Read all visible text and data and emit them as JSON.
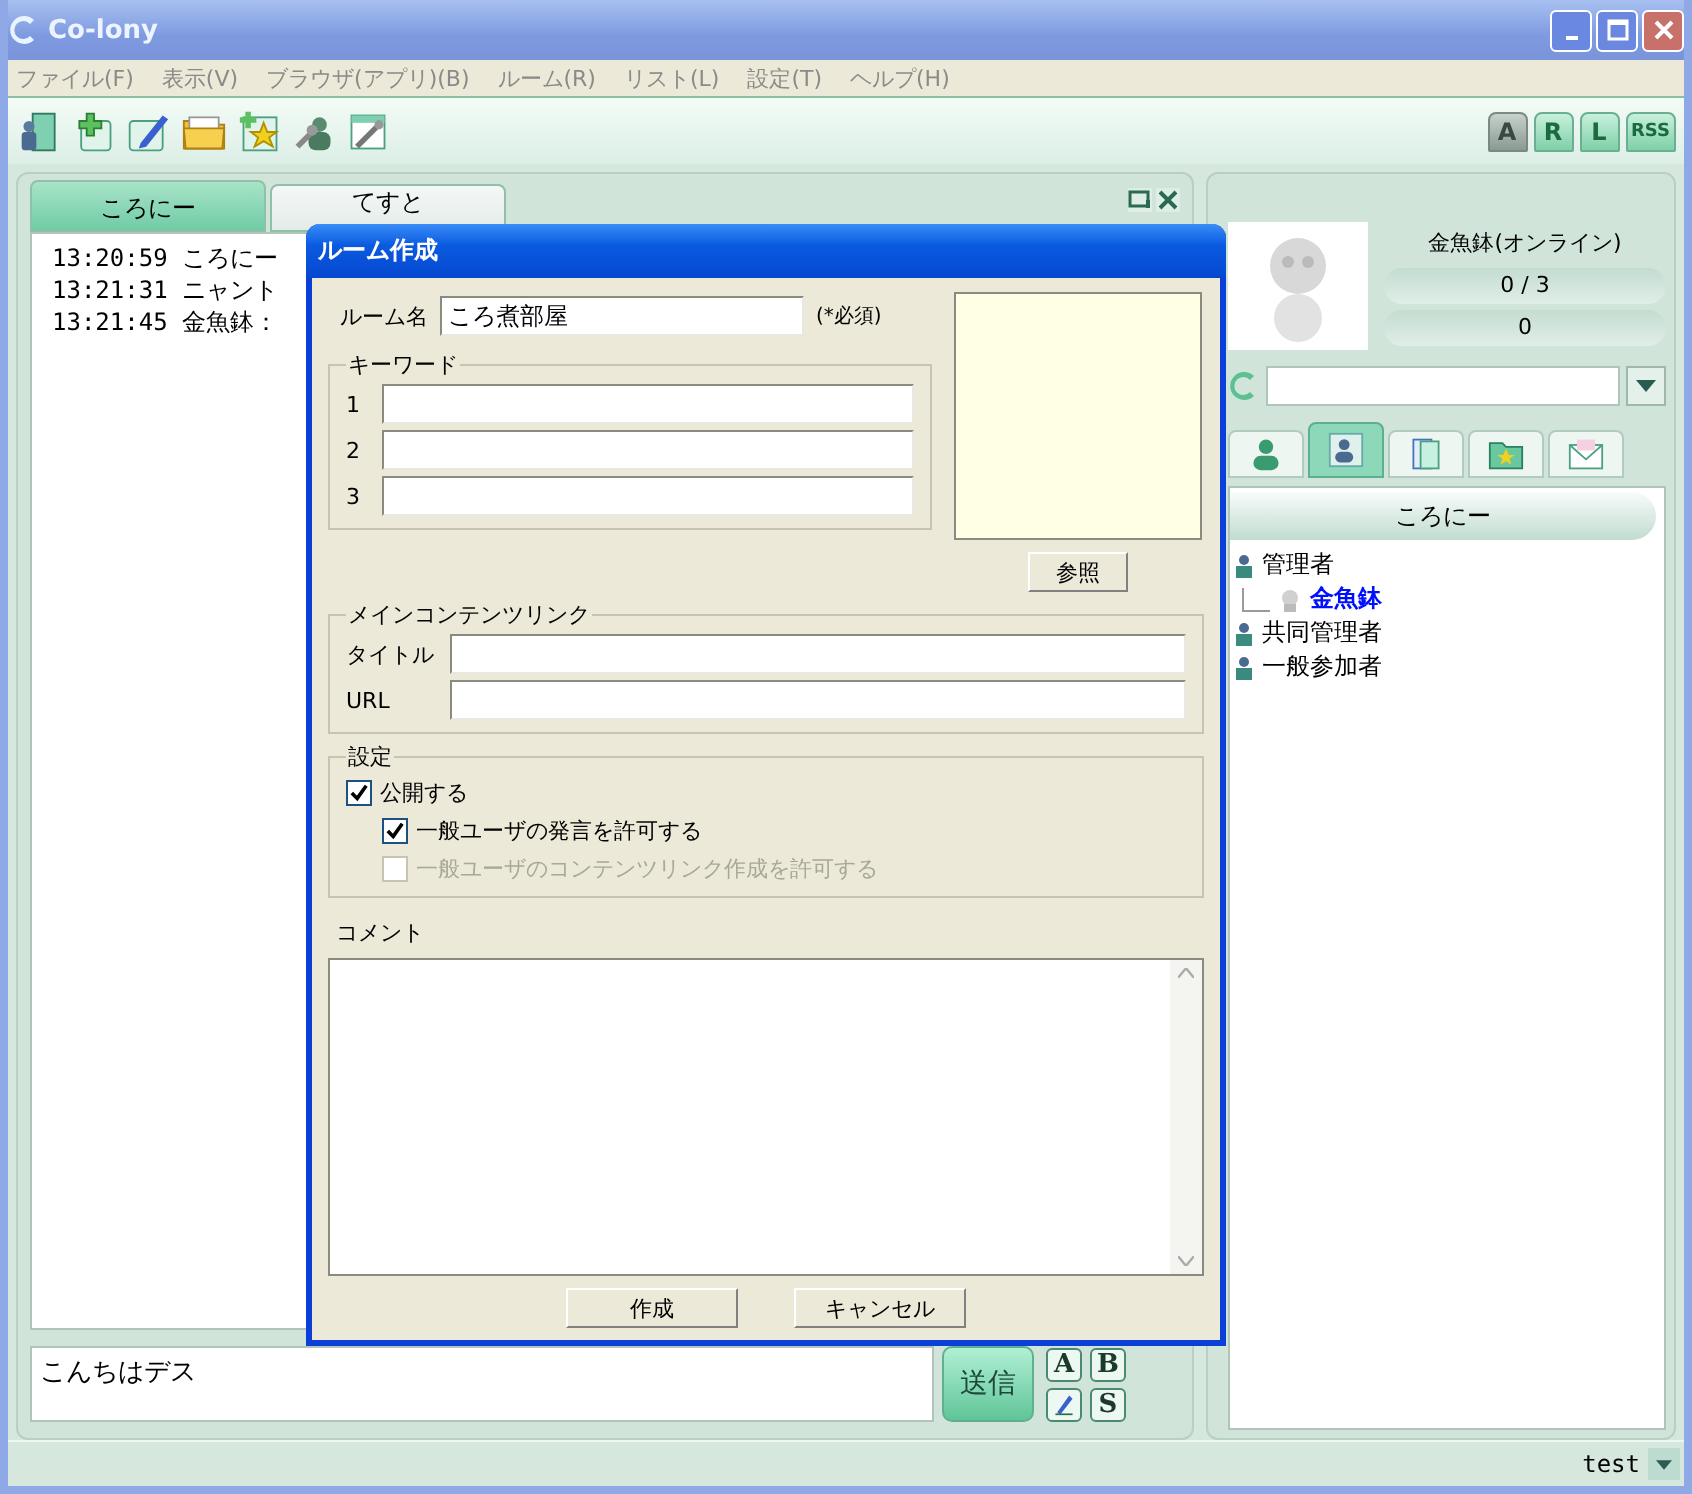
{
  "window": {
    "title": "Co-lony"
  },
  "menu": [
    "ファイル(F)",
    "表示(V)",
    "ブラウザ(アプリ)(B)",
    "ルーム(R)",
    "リスト(L)",
    "設定(T)",
    "ヘルプ(H)"
  ],
  "toolbar": [
    {
      "kind": "door"
    },
    {
      "kind": "add"
    },
    {
      "kind": "edit"
    },
    {
      "kind": "folder"
    },
    {
      "kind": "star"
    },
    {
      "kind": "tools"
    },
    {
      "kind": "settings"
    }
  ],
  "toolbar_right": [
    {
      "label": "A",
      "disabled": true
    },
    {
      "label": "R",
      "disabled": false
    },
    {
      "label": "L",
      "disabled": false
    },
    {
      "label": "RSS",
      "disabled": false
    }
  ],
  "chat": {
    "tabs": [
      {
        "label": "ころにー",
        "selected": true
      },
      {
        "label": "てすと",
        "selected": false
      }
    ],
    "lines": [
      {
        "time": "13:20:59",
        "text": "ころにー"
      },
      {
        "time": "13:21:31",
        "text": "ニャント"
      },
      {
        "time": "13:21:45",
        "text": "金魚鉢："
      }
    ],
    "input": {
      "value": "こんちはデス"
    },
    "send": "送信",
    "format_buttons": [
      {
        "kind": "letter",
        "label": "A"
      },
      {
        "kind": "letter",
        "label": "B"
      },
      {
        "kind": "pen"
      },
      {
        "kind": "letter",
        "label": "S"
      }
    ]
  },
  "profile": {
    "name": "金魚鉢(オンライン)",
    "count": "0 / 3",
    "score": "0"
  },
  "side_tabs": [
    {
      "kind": "person",
      "selected": false
    },
    {
      "kind": "people",
      "selected": true
    },
    {
      "kind": "door",
      "selected": false
    },
    {
      "kind": "star",
      "selected": false
    },
    {
      "kind": "mail",
      "selected": false
    }
  ],
  "member_tree": {
    "header": "ころにー",
    "groups": [
      {
        "label": "管理者",
        "children": [
          {
            "label": "金魚鉢"
          }
        ]
      },
      {
        "label": "共同管理者"
      },
      {
        "label": "一般参加者"
      }
    ]
  },
  "status_bar": {
    "user": "test"
  },
  "dialog": {
    "title": "ルーム作成",
    "room_name": {
      "label": "ルーム名",
      "value": "ころ煮部屋",
      "note": "(*必須)"
    },
    "browse": "参照",
    "keywords": {
      "legend": "キーワード",
      "items": [
        {
          "label": "1"
        },
        {
          "label": "2"
        },
        {
          "label": "3"
        }
      ]
    },
    "link": {
      "legend": "メインコンテンツリンク",
      "fields": [
        {
          "label": "タイトル"
        },
        {
          "label": "URL"
        }
      ]
    },
    "settings": {
      "legend": "設定",
      "options": [
        {
          "label": "公開する",
          "checked": true,
          "disabled": false,
          "children": [
            {
              "label": "一般ユーザの発言を許可する",
              "checked": true,
              "disabled": false
            },
            {
              "label": "一般ユーザのコンテンツリンク作成を許可する",
              "checked": false,
              "disabled": true
            }
          ]
        }
      ]
    },
    "comment": {
      "label": "コメント"
    },
    "buttons": [
      "作成",
      "キャンセル"
    ]
  }
}
